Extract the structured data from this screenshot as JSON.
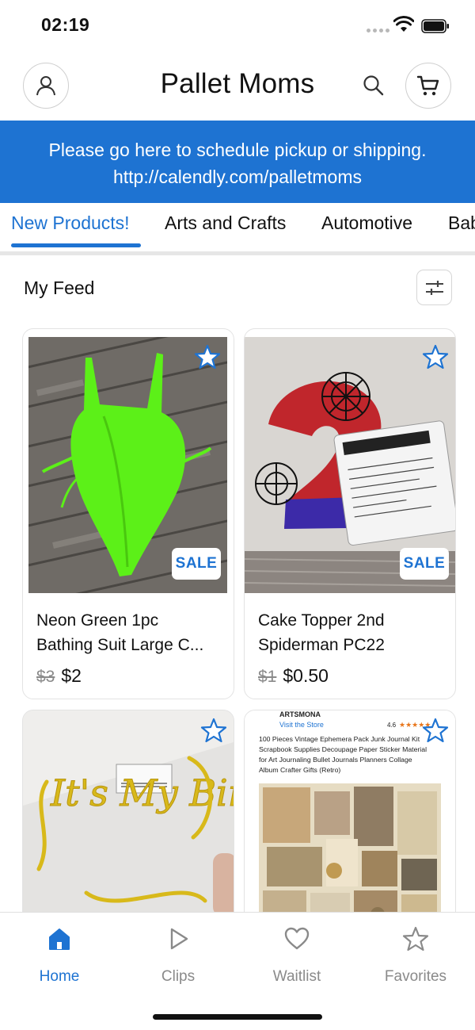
{
  "status_bar": {
    "time": "02:19"
  },
  "header": {
    "title": "Pallet Moms",
    "account_icon": "person-icon",
    "search_icon": "search-icon",
    "cart_icon": "cart-icon"
  },
  "banner": {
    "line1": "Please go here to schedule pickup or shipping.",
    "line2": "http://calendly.com/palletmoms"
  },
  "tabs": [
    {
      "label": "New Products!",
      "active": true
    },
    {
      "label": "Arts and Crafts",
      "active": false
    },
    {
      "label": "Automotive",
      "active": false
    },
    {
      "label": "Bab",
      "active": false
    }
  ],
  "feed": {
    "title": "My Feed",
    "filter_icon": "sliders-icon"
  },
  "products": [
    {
      "title_line1": "Neon Green 1pc",
      "title_line2": "Bathing Suit Large C...",
      "old_price": "$3",
      "price": "$2",
      "badge": "SALE"
    },
    {
      "title_line1": "Cake Topper 2nd",
      "title_line2": "Spiderman PC22",
      "old_price": "$1",
      "price": "$0.50",
      "badge": "SALE"
    },
    {
      "image_text": "It's My Birthday"
    },
    {
      "image_text": {
        "brand": "ARTSMONA",
        "store_link": "Visit the Store",
        "rating": "4.6",
        "description_lines": [
          "100 Pieces Vintage Ephemera Pack Junk Journal Kit",
          "Scrapbook Supplies Decoupage Paper Sticker Material",
          "for Art Journaling Bullet Journals Planners Collage",
          "Album Crafter Gifts (Retro)"
        ]
      }
    }
  ],
  "bottom_nav": [
    {
      "label": "Home",
      "icon": "home-icon",
      "active": true
    },
    {
      "label": "Clips",
      "icon": "play-icon",
      "active": false
    },
    {
      "label": "Waitlist",
      "icon": "heart-icon",
      "active": false
    },
    {
      "label": "Favorites",
      "icon": "star-icon",
      "active": false
    }
  ],
  "colors": {
    "accent": "#1e73d2",
    "inactive": "#8a8a8a",
    "neon_green": "#5cf018"
  }
}
